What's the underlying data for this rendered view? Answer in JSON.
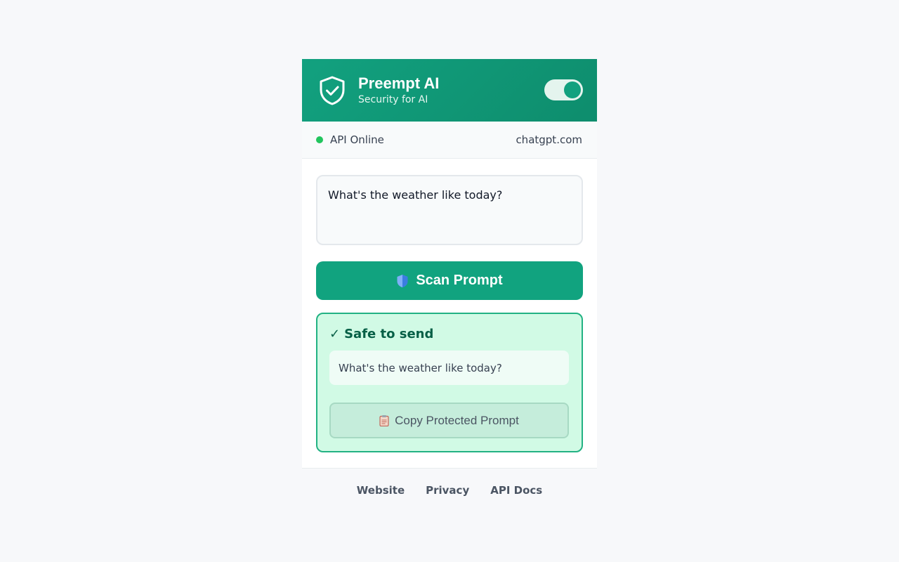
{
  "header": {
    "title": "Preempt AI",
    "subtitle": "Security for AI",
    "logo_icon": "shield-check-icon",
    "toggle_enabled": true
  },
  "status": {
    "text": "API Online",
    "indicator_color": "#22c55e",
    "domain": "chatgpt.com"
  },
  "prompt": {
    "value": "What's the weather like today?"
  },
  "scan_button": {
    "label": "Scan Prompt",
    "icon": "shield-icon"
  },
  "result": {
    "title": "Safe to send",
    "check": "✓",
    "sanitized_text": "What's the weather like today?",
    "copy_label": "Copy Protected Prompt",
    "copy_icon": "clipboard-icon"
  },
  "footer": {
    "links": [
      "Website",
      "Privacy",
      "API Docs"
    ]
  },
  "colors": {
    "brand": "#11a37f",
    "success_bg": "#d1fae5",
    "success_border": "#22b283",
    "success_text": "#065f46"
  }
}
